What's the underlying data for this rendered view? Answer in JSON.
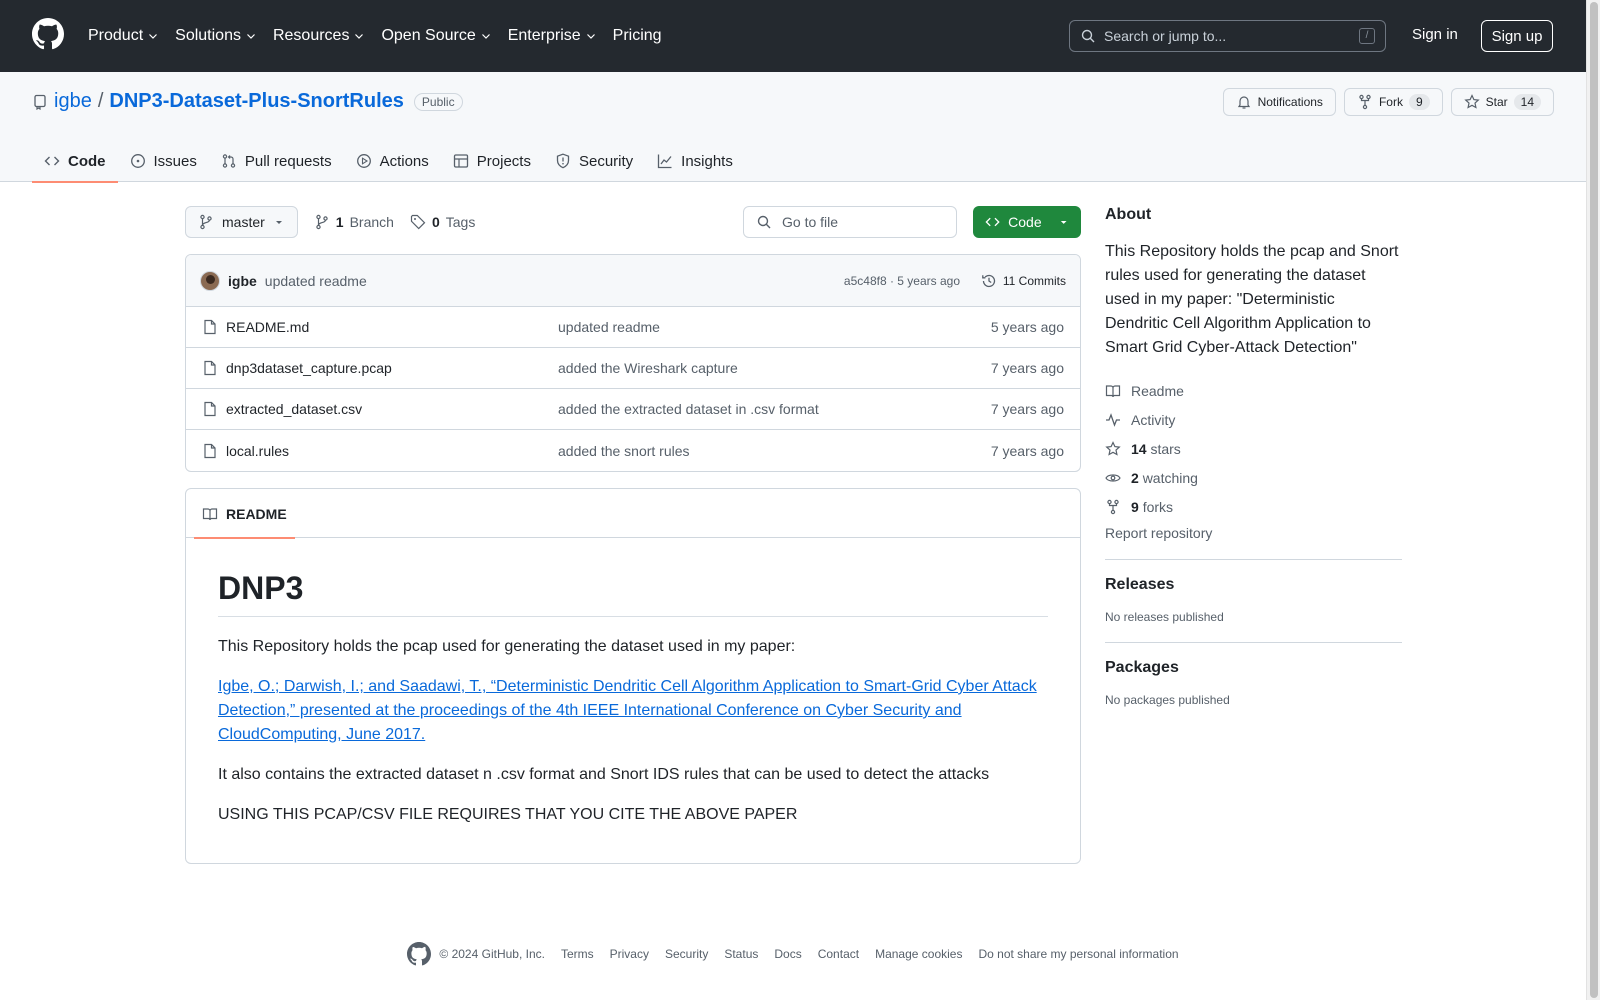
{
  "topnav": {
    "items": [
      "Product",
      "Solutions",
      "Resources",
      "Open Source",
      "Enterprise",
      "Pricing"
    ],
    "search_placeholder": "Search or jump to...",
    "search_shortcut": "/",
    "signin": "Sign in",
    "signup": "Sign up"
  },
  "repo": {
    "owner": "igbe",
    "sep": "/",
    "name": "DNP3-Dataset-Plus-SnortRules",
    "visibility": "Public",
    "notifications": "Notifications",
    "fork_label": "Fork",
    "fork_count": "9",
    "star_label": "Star",
    "star_count": "14"
  },
  "tabs": [
    "Code",
    "Issues",
    "Pull requests",
    "Actions",
    "Projects",
    "Security",
    "Insights"
  ],
  "toolbar": {
    "branch": "master",
    "branch_count": "1",
    "branch_label": "Branch",
    "tag_count": "0",
    "tag_label": "Tags",
    "goto_placeholder": "Go to file",
    "code_button": "Code"
  },
  "commit": {
    "author": "igbe",
    "message": "updated readme",
    "meta": "a5c48f8 · 5 years ago",
    "commits": "11 Commits"
  },
  "files": [
    {
      "name": "README.md",
      "message": "updated readme",
      "date": "5 years ago"
    },
    {
      "name": "dnp3dataset_capture.pcap",
      "message": "added the Wireshark capture",
      "date": "7 years ago"
    },
    {
      "name": "extracted_dataset.csv",
      "message": "added the extracted dataset in .csv format",
      "date": "7 years ago"
    },
    {
      "name": "local.rules",
      "message": "added the snort rules",
      "date": "7 years ago"
    }
  ],
  "readme": {
    "tab": "README",
    "heading": "DNP3",
    "p1": "This Repository holds the pcap used for generating the dataset used in my paper:",
    "citation": "Igbe, O.; Darwish, I.; and Saadawi, T., “Deterministic Dendritic Cell Algorithm Application to Smart-Grid Cyber Attack Detection,” presented at the proceedings of the 4th IEEE International Conference on Cyber Security and CloudComputing, June 2017.",
    "p2": "It also contains the extracted dataset n .csv format and Snort IDS rules that can be used to detect the attacks",
    "p3": "USING THIS PCAP/CSV FILE REQUIRES THAT YOU CITE THE ABOVE PAPER"
  },
  "sidebar": {
    "about_heading": "About",
    "about_text": "This Repository holds the pcap and Snort rules used for generating the dataset used in my paper: \"Deterministic Dendritic Cell Algorithm Application to Smart Grid Cyber-Attack Detection\"",
    "readme": "Readme",
    "activity": "Activity",
    "stars_count": "14",
    "stars_label": "stars",
    "watching_count": "2",
    "watching_label": "watching",
    "forks_count": "9",
    "forks_label": "forks",
    "report": "Report repository",
    "releases_heading": "Releases",
    "releases_text": "No releases published",
    "packages_heading": "Packages",
    "packages_text": "No packages published"
  },
  "footer": {
    "copyright": "© 2024 GitHub, Inc.",
    "links": [
      "Terms",
      "Privacy",
      "Security",
      "Status",
      "Docs",
      "Contact",
      "Manage cookies",
      "Do not share my personal information"
    ]
  },
  "colors": {
    "header_bg": "#24292f",
    "link": "#0969da",
    "code_button": "#1f883d",
    "tab_underline": "#fd8c73"
  }
}
